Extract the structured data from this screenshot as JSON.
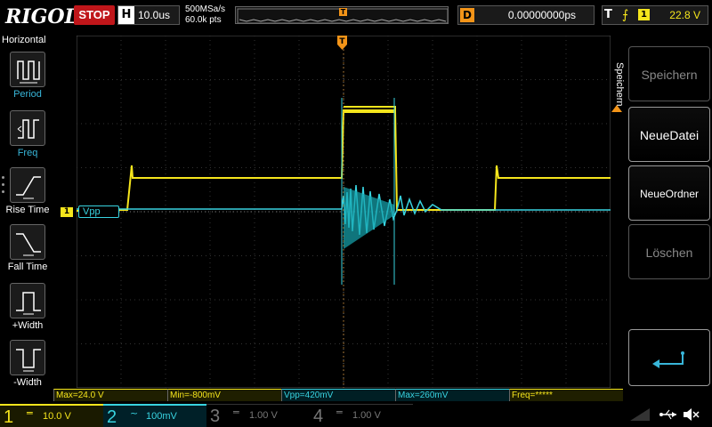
{
  "header": {
    "brand": "RIGOL",
    "run_state": "STOP",
    "timebase_label": "H",
    "timebase_value": "10.0us",
    "sample_rate": "500MSa/s",
    "memory_depth": "60.0k pts",
    "trigger_marker": "T",
    "delay_label": "D",
    "delay_value": "0.00000000ps",
    "trigger_label": "T",
    "trigger_edge": "⨍",
    "trigger_channel": "1",
    "trigger_level": "22.8 V"
  },
  "left_menu": {
    "title": "Horizontal",
    "items": [
      {
        "label": "Period",
        "icon": "period-icon"
      },
      {
        "label": "Freq",
        "icon": "frequency-icon"
      },
      {
        "label": "Rise Time",
        "icon": "rise-time-icon"
      },
      {
        "label": "Fall Time",
        "icon": "fall-time-icon"
      },
      {
        "label": "+Width",
        "icon": "positive-width-icon"
      },
      {
        "label": "-Width",
        "icon": "negative-width-icon"
      }
    ]
  },
  "right_menu": {
    "title": "Speichern",
    "buttons": [
      {
        "label": "Speichern",
        "enabled": false
      },
      {
        "label": "NeueDatei",
        "enabled": true
      },
      {
        "label": "NeueOrdner",
        "enabled": true
      },
      {
        "label": "Löschen",
        "enabled": false
      }
    ],
    "back_icon": "return-arrow-icon"
  },
  "waveform": {
    "ch1_marker": "1",
    "measurement_tag": "Vpp",
    "ch1_color": "#f5e51c",
    "ch2_color": "#38d3e0",
    "trigger_color": "#f39418"
  },
  "measurements": [
    {
      "text": "Max=24.0 V",
      "channel": 1
    },
    {
      "text": "Min=-800mV",
      "channel": 1
    },
    {
      "text": "Vpp=420mV",
      "channel": 2
    },
    {
      "text": "Max=260mV",
      "channel": 2
    },
    {
      "text": "Freq=*****",
      "channel": 1
    }
  ],
  "channels": [
    {
      "num": "1",
      "coupling": "═",
      "scale": "10.0 V"
    },
    {
      "num": "2",
      "coupling": "~",
      "scale": "100mV"
    },
    {
      "num": "3",
      "coupling": "═",
      "scale": "1.00 V"
    },
    {
      "num": "4",
      "coupling": "═",
      "scale": "1.00 V"
    }
  ],
  "status_icons": [
    "usb-icon",
    "speaker-mute-icon"
  ]
}
